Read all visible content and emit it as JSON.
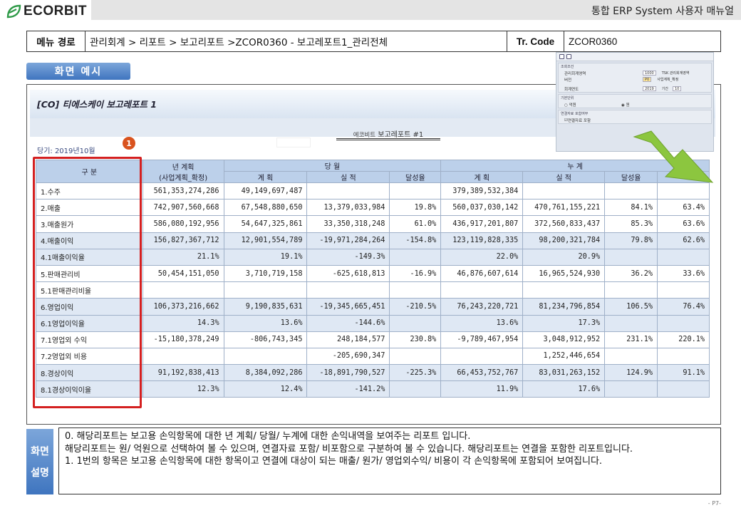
{
  "brand": {
    "logo_text": "ECORBIT",
    "doc_title": "통합 ERP System 사용자 매뉴얼"
  },
  "menu_path": {
    "label": "메뉴 경로",
    "path": "관리회계 > 리포트 > 보고리포트 >ZCOR0360 - 보고레포트1_관리전체",
    "tr_label": "Tr. Code",
    "tr_value": "ZCOR0360"
  },
  "screen_tab": "화면 예시",
  "report": {
    "title": "[CO] 티에스케이 보고레포트 1",
    "company_small": "에코비트",
    "subtitle": "보고레포트 #1",
    "period": "당기: 2019년10월",
    "marker": "1",
    "headers": {
      "category": "구 분",
      "annual_plan": "년 계획",
      "annual_plan_sub": "(사업계획_확정)",
      "current_month": "당 월",
      "cumulative": "누 계",
      "plan": "계 획",
      "actual": "실 적",
      "rate": "달성율"
    },
    "rows": [
      {
        "label": "1.수주",
        "annual": "561,353,274,286",
        "m_plan": "49,149,697,487",
        "m_act": "",
        "m_rate": "",
        "c_plan": "379,389,532,384",
        "c_act": "",
        "c_rate": "",
        "extra": ""
      },
      {
        "label": "2.매출",
        "annual": "742,907,560,668",
        "m_plan": "67,548,880,650",
        "m_act": "13,379,033,984",
        "m_rate": "19.8%",
        "c_plan": "560,037,030,142",
        "c_act": "470,761,155,221",
        "c_rate": "84.1%",
        "extra": "63.4%"
      },
      {
        "label": "3.매출원가",
        "annual": "586,080,192,956",
        "m_plan": "54,647,325,861",
        "m_act": "33,350,318,248",
        "m_rate": "61.0%",
        "c_plan": "436,917,201,807",
        "c_act": "372,560,833,437",
        "c_rate": "85.3%",
        "extra": "63.6%"
      },
      {
        "label": "4.매출이익",
        "annual": "156,827,367,712",
        "m_plan": "12,901,554,789",
        "m_act": "-19,971,284,264",
        "m_rate": "-154.8%",
        "c_plan": "123,119,828,335",
        "c_act": "98,200,321,784",
        "c_rate": "79.8%",
        "extra": "62.6%"
      },
      {
        "label": "4.1매출이익율",
        "annual": "21.1%",
        "m_plan": "19.1%",
        "m_act": "-149.3%",
        "m_rate": "",
        "c_plan": "22.0%",
        "c_act": "20.9%",
        "c_rate": "",
        "extra": ""
      },
      {
        "label": "5.판매관리비",
        "annual": "50,454,151,050",
        "m_plan": "3,710,719,158",
        "m_act": "-625,618,813",
        "m_rate": "-16.9%",
        "c_plan": "46,876,607,614",
        "c_act": "16,965,524,930",
        "c_rate": "36.2%",
        "extra": "33.6%"
      },
      {
        "label": "5.1판매관리비율",
        "annual": "",
        "m_plan": "",
        "m_act": "",
        "m_rate": "",
        "c_plan": "",
        "c_act": "",
        "c_rate": "",
        "extra": ""
      },
      {
        "label": "6.영업이익",
        "annual": "106,373,216,662",
        "m_plan": "9,190,835,631",
        "m_act": "-19,345,665,451",
        "m_rate": "-210.5%",
        "c_plan": "76,243,220,721",
        "c_act": "81,234,796,854",
        "c_rate": "106.5%",
        "extra": "76.4%"
      },
      {
        "label": "6.1영업이익율",
        "annual": "14.3%",
        "m_plan": "13.6%",
        "m_act": "-144.6%",
        "m_rate": "",
        "c_plan": "13.6%",
        "c_act": "17.3%",
        "c_rate": "",
        "extra": ""
      },
      {
        "label": "7.1영업외 수익",
        "annual": "-15,180,378,249",
        "m_plan": "-806,743,345",
        "m_act": "248,184,577",
        "m_rate": "230.8%",
        "c_plan": "-9,789,467,954",
        "c_act": "3,048,912,952",
        "c_rate": "231.1%",
        "extra": "220.1%"
      },
      {
        "label": "7.2영업외 비용",
        "annual": "",
        "m_plan": "",
        "m_act": "-205,690,347",
        "m_rate": "",
        "c_plan": "",
        "c_act": "1,252,446,654",
        "c_rate": "",
        "extra": ""
      },
      {
        "label": "8.경상이익",
        "annual": "91,192,838,413",
        "m_plan": "8,384,092,286",
        "m_act": "-18,891,790,527",
        "m_rate": "-225.3%",
        "c_plan": "66,453,752,767",
        "c_act": "83,031,263,152",
        "c_rate": "124.9%",
        "extra": "91.1%"
      },
      {
        "label": "8.1경상이익이율",
        "annual": "12.3%",
        "m_plan": "12.4%",
        "m_act": "-141.2%",
        "m_rate": "",
        "c_plan": "11.9%",
        "c_act": "17.6%",
        "c_rate": "",
        "extra": ""
      }
    ]
  },
  "selection_popup": {
    "group1_title": "조회조건",
    "f1_label": "관리회계영역",
    "f1_value": "1000",
    "f1_desc": "TSK 관리회계영역",
    "f2_label": "버전",
    "f2_value": "P0",
    "f2_desc": "사업계획_확정",
    "f3_label": "회계연도",
    "f3_value": "2019",
    "f3_period_label": "기간",
    "f3_period": "10",
    "group2_title": "기본단위",
    "opt1": "억원",
    "opt2": "원",
    "group3_title": "연결자료 포함여부",
    "chk1": "연결자료 포함"
  },
  "explanation": {
    "tab_line1": "화면",
    "tab_line2": "설명",
    "line0": "0. 해당리포트는  보고용 손익항목에 대한 년 계획/ 당월/ 누계에 대한 손익내역을 보여주는 리포트 입니다.",
    "line1": "해당리포트는 원/ 억원으로 선택하여 볼 수 있으며, 연결자료 포함/ 비포함으로 구분하여 볼 수 있습니다. 해당리포트는 연결을 포함한 리포트입니다.",
    "line2": "1.   1번의 항목은 보고용 손익항목에 대한 항목이고 연결에 대상이 되는 매출/ 원가/ 영업외수익/ 비용이 각 손익항목에 포함되어 보여집니다."
  },
  "page_number": "- P7-"
}
